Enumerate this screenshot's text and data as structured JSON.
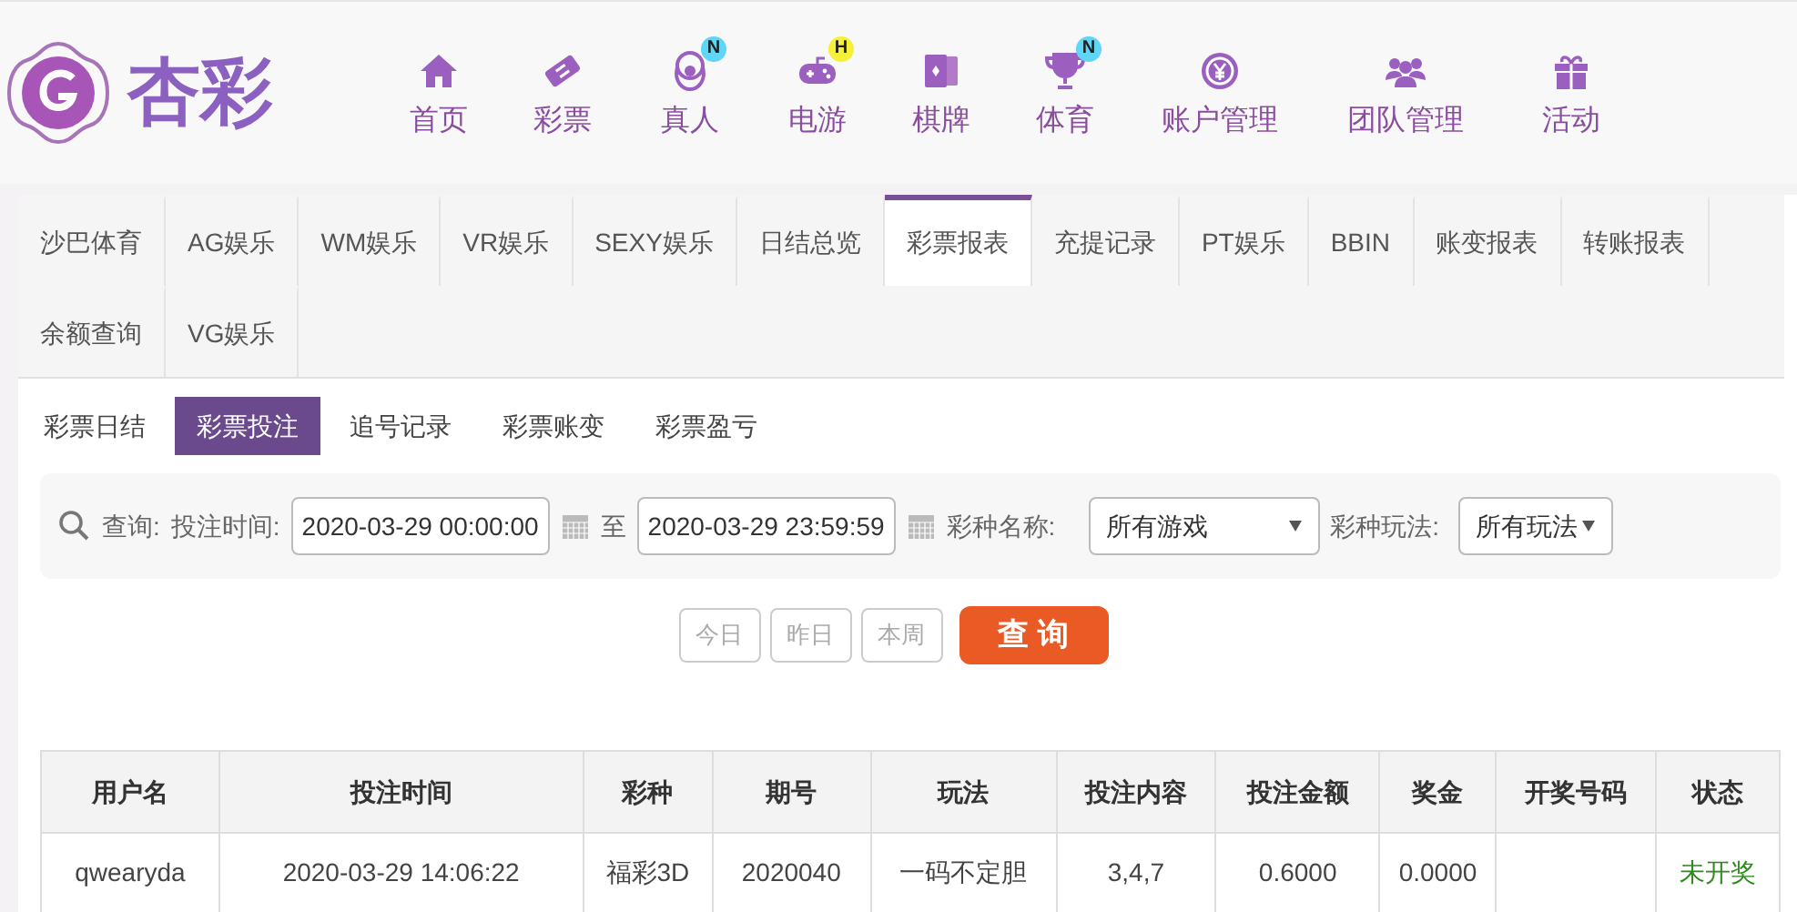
{
  "logo": {
    "text": "杏彩"
  },
  "nav": [
    {
      "label": "首页"
    },
    {
      "label": "彩票"
    },
    {
      "label": "真人",
      "badge": "N"
    },
    {
      "label": "电游",
      "badge": "H"
    },
    {
      "label": "棋牌"
    },
    {
      "label": "体育",
      "badge": "N"
    },
    {
      "label": "账户管理"
    },
    {
      "label": "团队管理"
    },
    {
      "label": "活动"
    }
  ],
  "tabs": [
    {
      "label": "沙巴体育",
      "selected": false
    },
    {
      "label": "AG娱乐",
      "selected": false
    },
    {
      "label": "WM娱乐",
      "selected": false
    },
    {
      "label": "VR娱乐",
      "selected": false
    },
    {
      "label": "SEXY娱乐",
      "selected": false
    },
    {
      "label": "日结总览",
      "selected": false
    },
    {
      "label": "彩票报表",
      "selected": true
    },
    {
      "label": "充提记录",
      "selected": false
    },
    {
      "label": "PT娱乐",
      "selected": false
    },
    {
      "label": "BBIN",
      "selected": false
    },
    {
      "label": "账变报表",
      "selected": false
    },
    {
      "label": "转账报表",
      "selected": false
    },
    {
      "label": "余额查询",
      "selected": false
    },
    {
      "label": "VG娱乐",
      "selected": false
    }
  ],
  "subtabs": [
    {
      "label": "彩票日结",
      "selected": false
    },
    {
      "label": "彩票投注",
      "selected": true
    },
    {
      "label": "追号记录",
      "selected": false
    },
    {
      "label": "彩票账变",
      "selected": false
    },
    {
      "label": "彩票盈亏",
      "selected": false
    }
  ],
  "filter": {
    "query_label": "查询:",
    "time_label": "投注时间:",
    "start": "2020-03-29 00:00:00",
    "to": "至",
    "end": "2020-03-29 23:59:59",
    "game_label": "彩种名称:",
    "game": "所有游戏",
    "play_label": "彩种玩法:",
    "play": "所有玩法"
  },
  "quick_buttons": [
    "今日",
    "昨日",
    "本周"
  ],
  "search_button": "查 询",
  "table": {
    "columns": [
      "用户名",
      "投注时间",
      "彩种",
      "期号",
      "玩法",
      "投注内容",
      "投注金额",
      "奖金",
      "开奖号码",
      "状态"
    ],
    "rows": [
      {
        "cells": [
          "qwearyda",
          "2020-03-29 14:06:22",
          "福彩3D",
          "2020040",
          "一码不定胆",
          "3,4,7",
          "0.6000",
          "0.0000",
          ""
        ],
        "status": "未开奖",
        "color": "#2e8b1e"
      }
    ]
  }
}
